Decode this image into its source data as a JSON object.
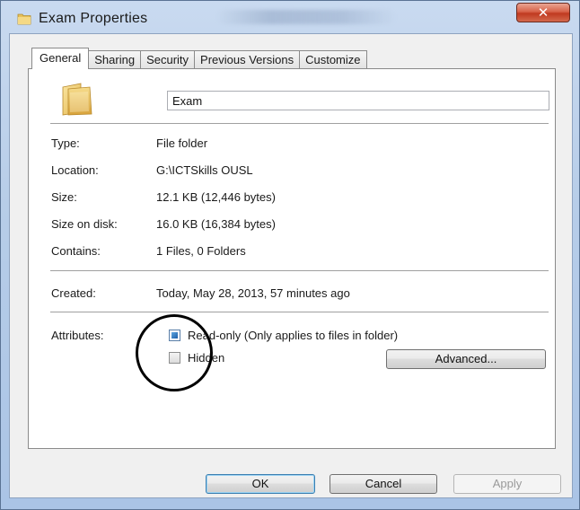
{
  "window": {
    "title": "Exam Properties",
    "close_glyph": "✕"
  },
  "tabs": [
    {
      "label": "General",
      "active": true
    },
    {
      "label": "Sharing",
      "active": false
    },
    {
      "label": "Security",
      "active": false
    },
    {
      "label": "Previous Versions",
      "active": false
    },
    {
      "label": "Customize",
      "active": false
    }
  ],
  "general": {
    "icon": "folder-icon",
    "name_value": "Exam",
    "rows": [
      {
        "label": "Type:",
        "value": "File folder"
      },
      {
        "label": "Location:",
        "value": "G:\\ICTSkills OUSL"
      },
      {
        "label": "Size:",
        "value": "12.1 KB (12,446 bytes)"
      },
      {
        "label": "Size on disk:",
        "value": "16.0 KB (16,384 bytes)"
      },
      {
        "label": "Contains:",
        "value": "1 Files, 0 Folders"
      }
    ],
    "created": {
      "label": "Created:",
      "value": "Today, May 28, 2013, 57 minutes ago"
    },
    "attributes": {
      "label": "Attributes:",
      "read_only": {
        "label": "Read-only (Only applies to files in folder)",
        "state": "indeterminate"
      },
      "hidden": {
        "label": "Hidden",
        "state": "unchecked"
      },
      "advanced_label": "Advanced..."
    }
  },
  "buttons": {
    "ok": "OK",
    "cancel": "Cancel",
    "apply": "Apply"
  },
  "colors": {
    "accent_blue": "#3c7fb1",
    "close_red": "#c0391f"
  }
}
